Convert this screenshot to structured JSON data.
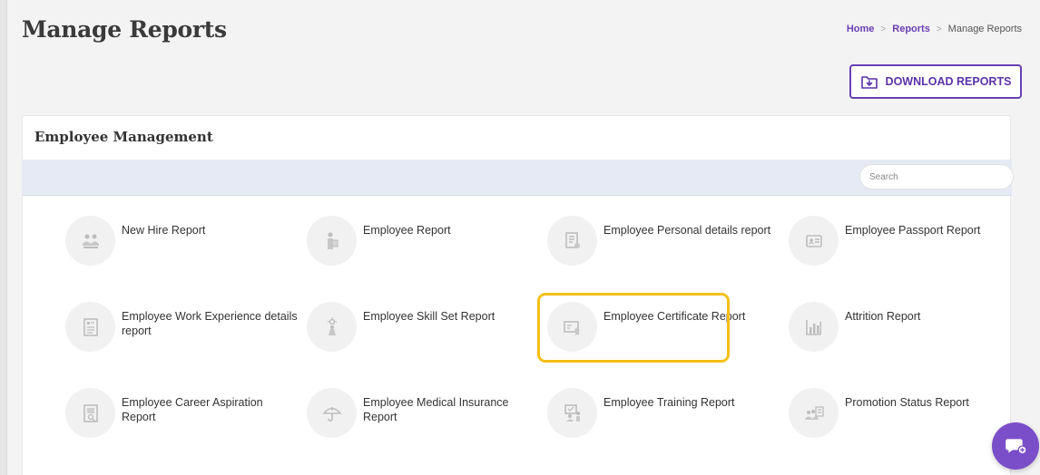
{
  "page": {
    "title": "Manage Reports"
  },
  "breadcrumb": {
    "home": "Home",
    "reports": "Reports",
    "current": "Manage Reports"
  },
  "actions": {
    "download_label": "DOWNLOAD REPORTS"
  },
  "section": {
    "title": "Employee Management",
    "search_placeholder": "Search"
  },
  "reports": [
    {
      "label": "New Hire Report",
      "icon": "new-hire-icon"
    },
    {
      "label": "Employee Report",
      "icon": "employee-icon"
    },
    {
      "label": "Employee Personal details report",
      "icon": "personal-details-icon"
    },
    {
      "label": "Employee Passport Report",
      "icon": "passport-icon"
    },
    {
      "label": "Employee Work Experience details report",
      "icon": "work-experience-icon"
    },
    {
      "label": "Employee Skill Set Report",
      "icon": "skill-set-icon"
    },
    {
      "label": "Employee Certificate Report",
      "icon": "certificate-icon"
    },
    {
      "label": "Attrition Report",
      "icon": "attrition-chart-icon"
    },
    {
      "label": "Employee Career Aspiration Report",
      "icon": "career-aspiration-icon"
    },
    {
      "label": "Employee Medical Insurance Report",
      "icon": "medical-insurance-icon"
    },
    {
      "label": "Employee Training Report",
      "icon": "training-icon"
    },
    {
      "label": "Promotion Status Report",
      "icon": "promotion-status-icon"
    }
  ],
  "highlighted_report": "Employee Certificate Report",
  "colors": {
    "accent": "#6a3fb3",
    "highlight": "#f5bf18",
    "chat": "#7b4ec9"
  }
}
